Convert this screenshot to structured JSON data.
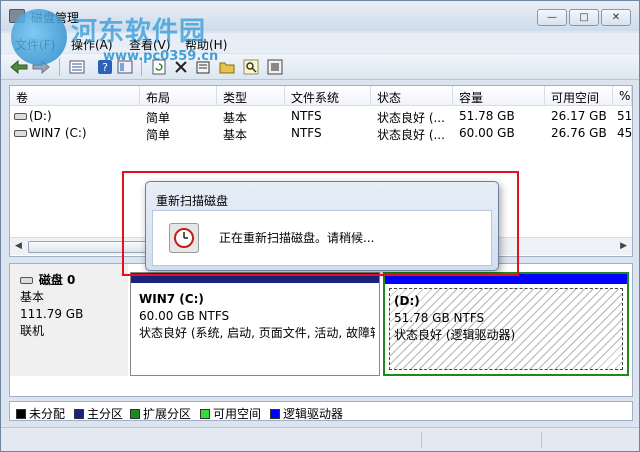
{
  "window": {
    "title": "磁盘管理",
    "min_label": "—",
    "max_label": "□",
    "close_label": "✕"
  },
  "watermark": {
    "name": "河东软件园",
    "url": "www.pc0359.cn"
  },
  "menu": {
    "file": "文件(F)",
    "action": "操作(A)",
    "view": "查看(V)",
    "help": "帮助(H)"
  },
  "toolbar": {
    "icons": [
      "back-arrow-icon",
      "forward-arrow-icon",
      "list-view-icon",
      "help-icon",
      "show-hide-icon",
      "refresh-icon",
      "delete-icon",
      "properties-icon",
      "open-icon",
      "search-icon",
      "export-icon"
    ]
  },
  "volume_list": {
    "columns": [
      "卷",
      "布局",
      "类型",
      "文件系统",
      "状态",
      "容量",
      "可用空间",
      "%"
    ],
    "rows": [
      {
        "volume": "(D:)",
        "layout": "简单",
        "type": "基本",
        "fs": "NTFS",
        "status": "状态良好 (...",
        "capacity": "51.78 GB",
        "free": "26.17 GB",
        "pct": "51"
      },
      {
        "volume": "WIN7 (C:)",
        "layout": "简单",
        "type": "基本",
        "fs": "NTFS",
        "status": "状态良好 (...",
        "capacity": "60.00 GB",
        "free": "26.76 GB",
        "pct": "45"
      }
    ]
  },
  "disk": {
    "name": "磁盘 0",
    "type": "基本",
    "size": "111.79 GB",
    "state": "联机",
    "partitions": [
      {
        "name": "WIN7  (C:)",
        "size_fs": "60.00 GB NTFS",
        "status": "状态良好 (系统, 启动, 页面文件, 活动, 故障转",
        "bar_color": "#1a237e"
      },
      {
        "name": "(D:)",
        "size_fs": "51.78 GB NTFS",
        "status": "状态良好 (逻辑驱动器)",
        "bar_color": "#0000ff"
      }
    ]
  },
  "legend": [
    {
      "label": "未分配",
      "color": "#000000"
    },
    {
      "label": "主分区",
      "color": "#1a237e"
    },
    {
      "label": "扩展分区",
      "color": "#1d8a1d"
    },
    {
      "label": "可用空间",
      "color": "#33dd33"
    },
    {
      "label": "逻辑驱动器",
      "color": "#0000ff"
    }
  ],
  "dialog": {
    "title": "重新扫描磁盘",
    "message": "正在重新扫描磁盘。请稍候..."
  }
}
